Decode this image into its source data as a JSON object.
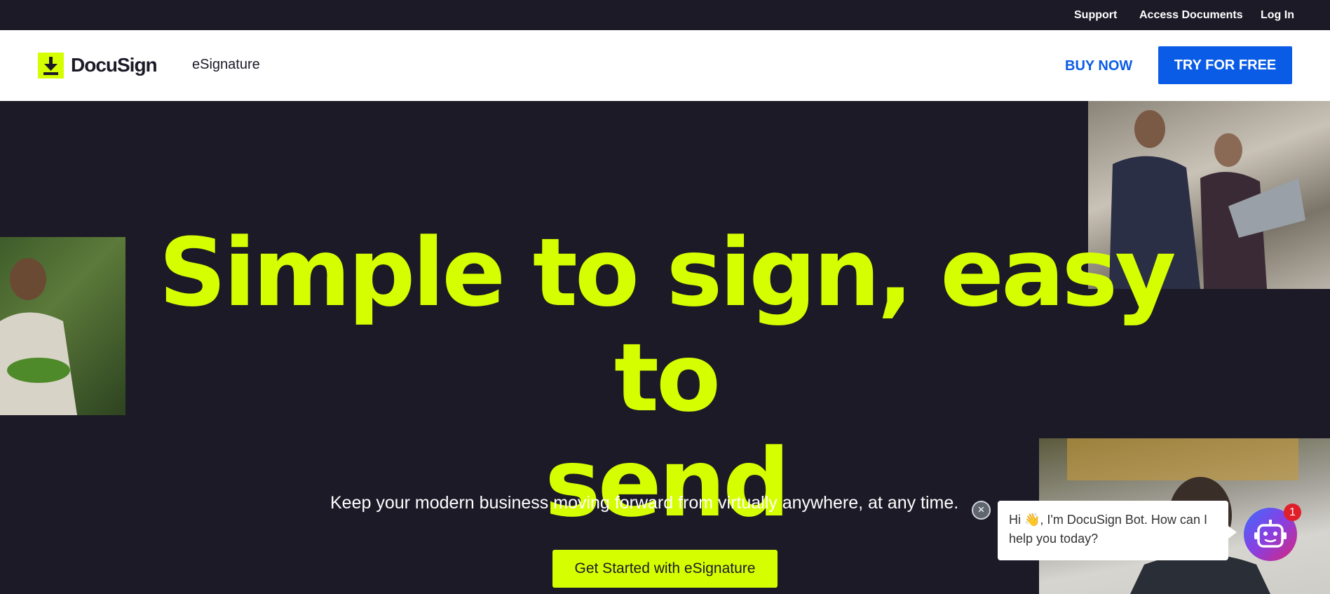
{
  "utility_nav": {
    "support": "Support",
    "access_documents": "Access Documents",
    "log_in": "Log In"
  },
  "header": {
    "logo_text": "DocuSign",
    "product_name": "eSignature",
    "buy_now": "BUY NOW",
    "try_free": "TRY FOR FREE"
  },
  "hero": {
    "headline_line1": "Simple to sign, easy to",
    "headline_line2": "send",
    "subtitle": "Keep your modern business moving forward from virtually anywhere, at any time.",
    "cta_label": "Get Started with eSignature"
  },
  "chatbot": {
    "greeting_before": "Hi ",
    "greeting_emoji": "👋",
    "greeting_after": ", I'm DocuSign Bot. How can I help you today?",
    "badge_count": "1",
    "close_glyph": "×"
  },
  "colors": {
    "accent_lime": "#d5ff00",
    "brand_blue": "#0a5ce6",
    "hero_bg": "#1c1a27"
  }
}
